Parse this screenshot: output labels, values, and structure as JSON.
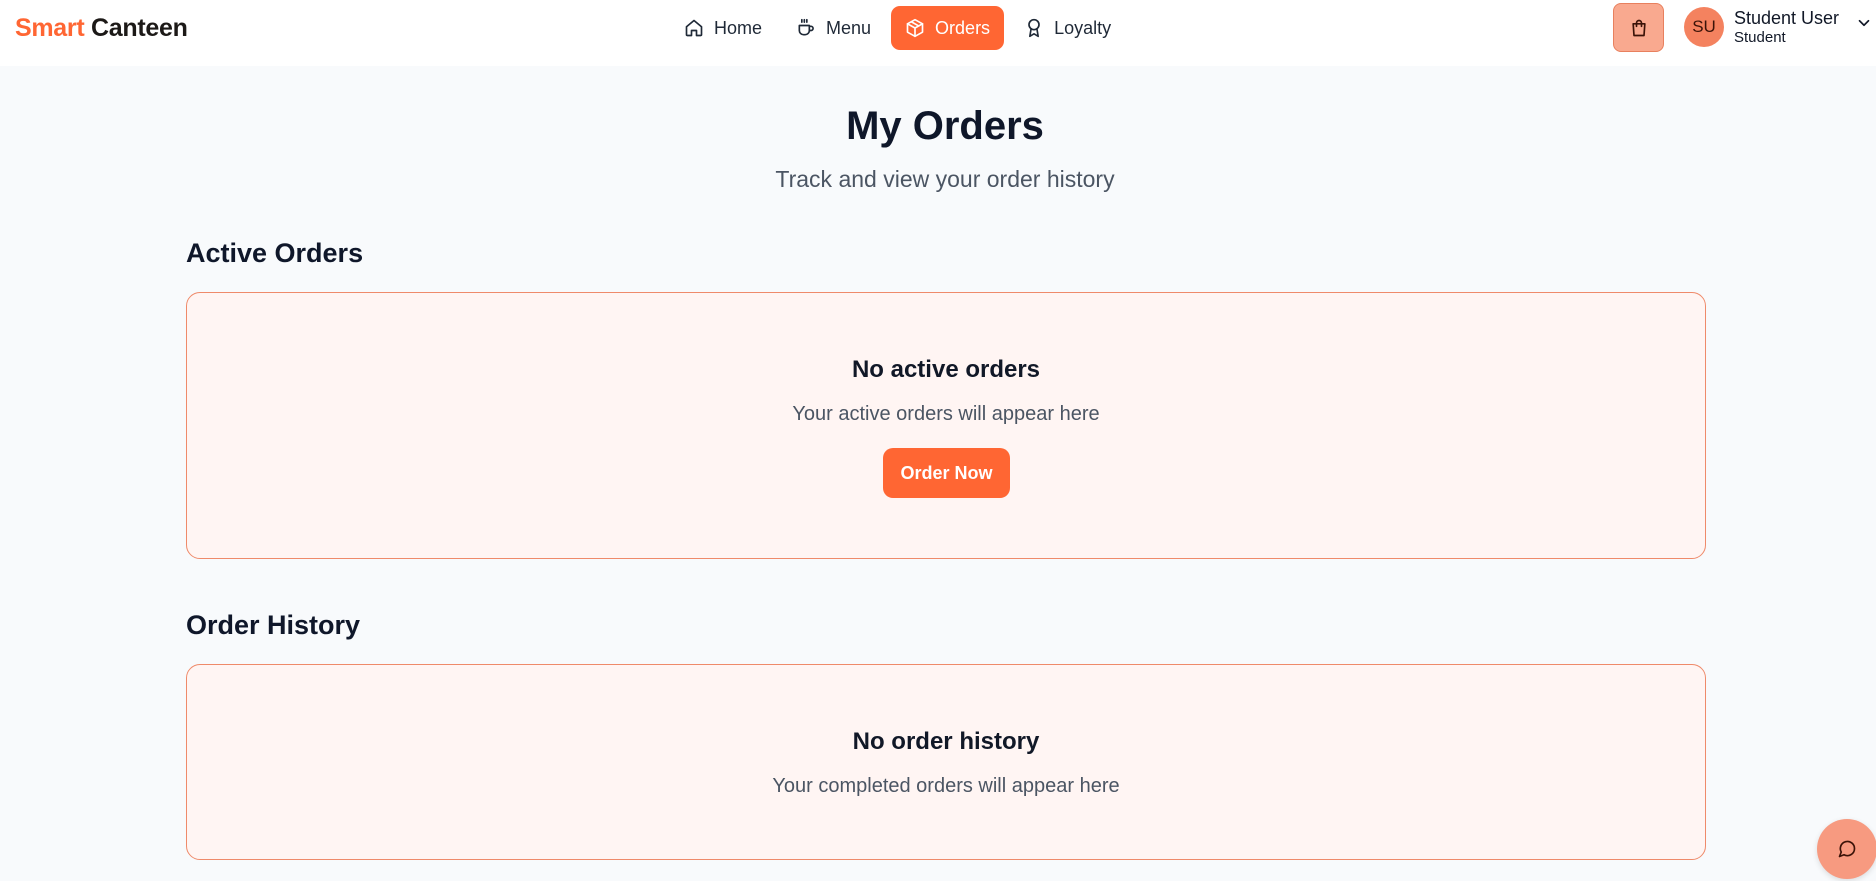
{
  "brand": {
    "part1": "Smart",
    "part2": "Canteen"
  },
  "nav": {
    "items": [
      {
        "label": "Home",
        "icon": "home-icon"
      },
      {
        "label": "Menu",
        "icon": "coffee-icon"
      },
      {
        "label": "Orders",
        "icon": "package-icon",
        "active": true
      },
      {
        "label": "Loyalty",
        "icon": "award-icon"
      }
    ]
  },
  "header": {
    "cart_icon": "shopping-bag-icon",
    "user": {
      "initials": "SU",
      "name": "Student User",
      "role": "Student"
    }
  },
  "page": {
    "title": "My Orders",
    "subtitle": "Track and view your order history"
  },
  "active_orders": {
    "heading": "Active Orders",
    "empty_title": "No active orders",
    "empty_text": "Your active orders will appear here",
    "button_label": "Order Now"
  },
  "order_history": {
    "heading": "Order History",
    "empty_title": "No order history",
    "empty_text": "Your completed orders will appear here"
  },
  "colors": {
    "accent": "#ff6633",
    "card_bg": "#fff5f3",
    "card_border": "#ef8a6a",
    "background": "#f8fafc"
  }
}
